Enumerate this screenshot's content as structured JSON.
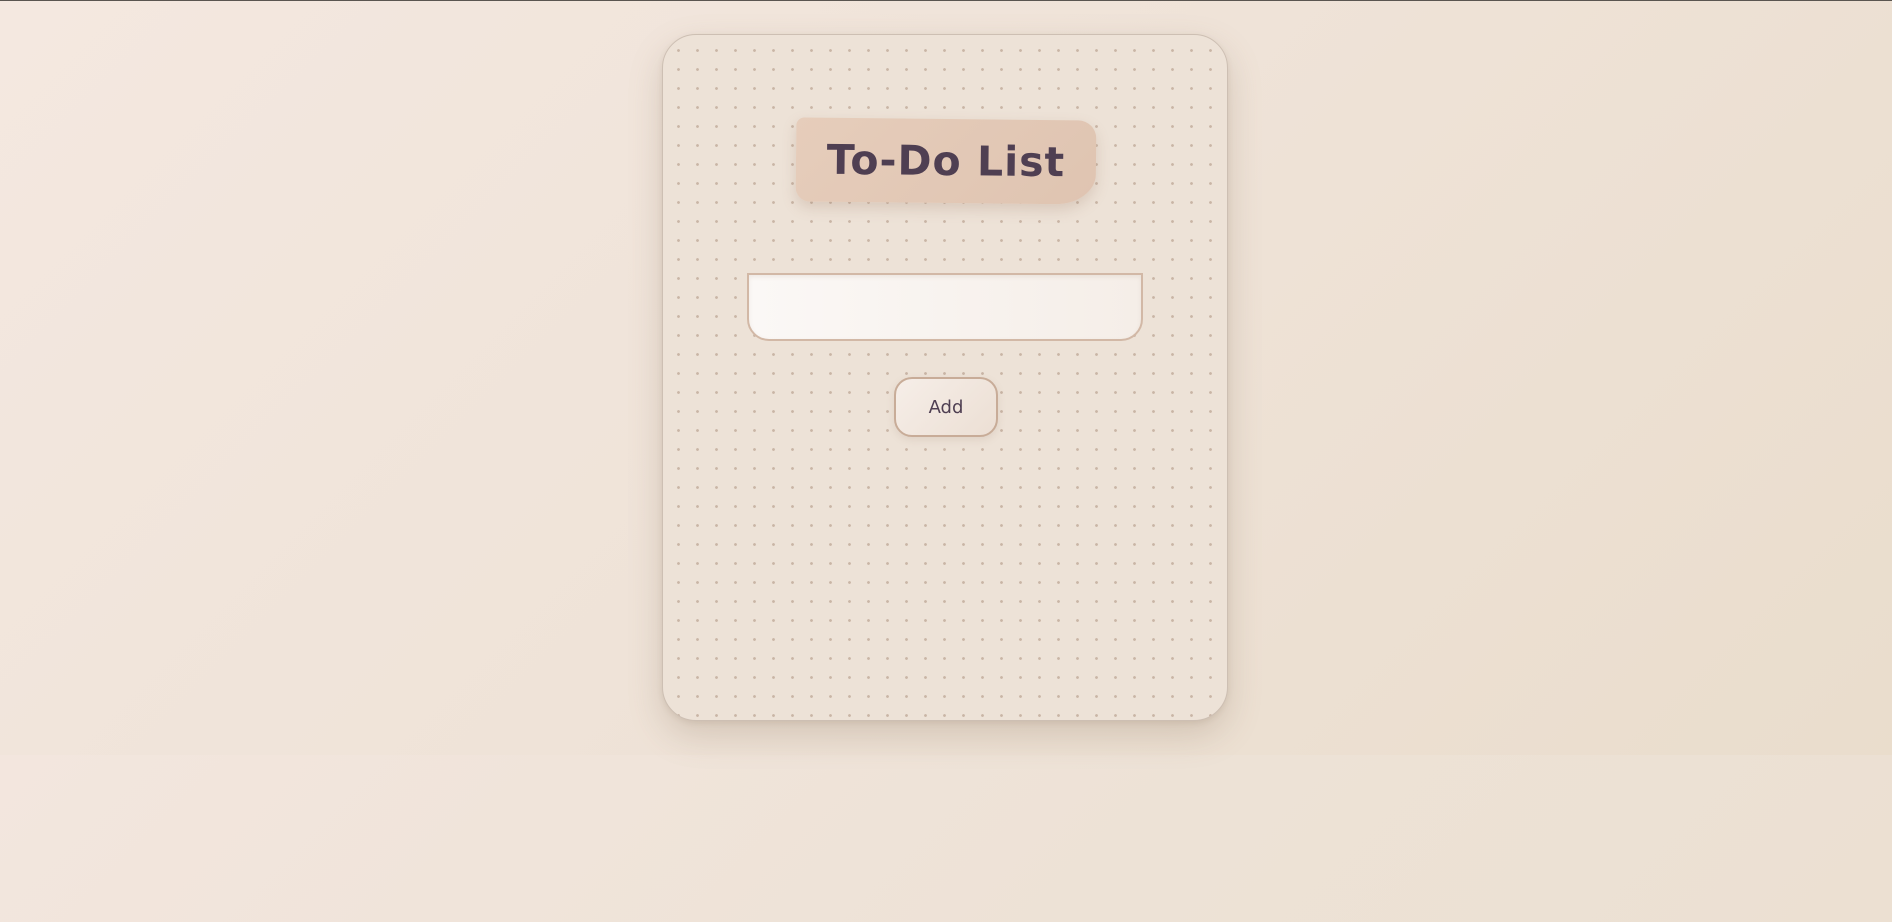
{
  "app": {
    "title": "To-Do List"
  },
  "task_input": {
    "value": "",
    "placeholder": ""
  },
  "add_button": {
    "label": "Add"
  },
  "colors": {
    "background": "#efe3d8",
    "card": "#ede2d7",
    "title_tag": "#e3c8b5",
    "text": "#4f3f52",
    "border": "#d2b8a6"
  }
}
